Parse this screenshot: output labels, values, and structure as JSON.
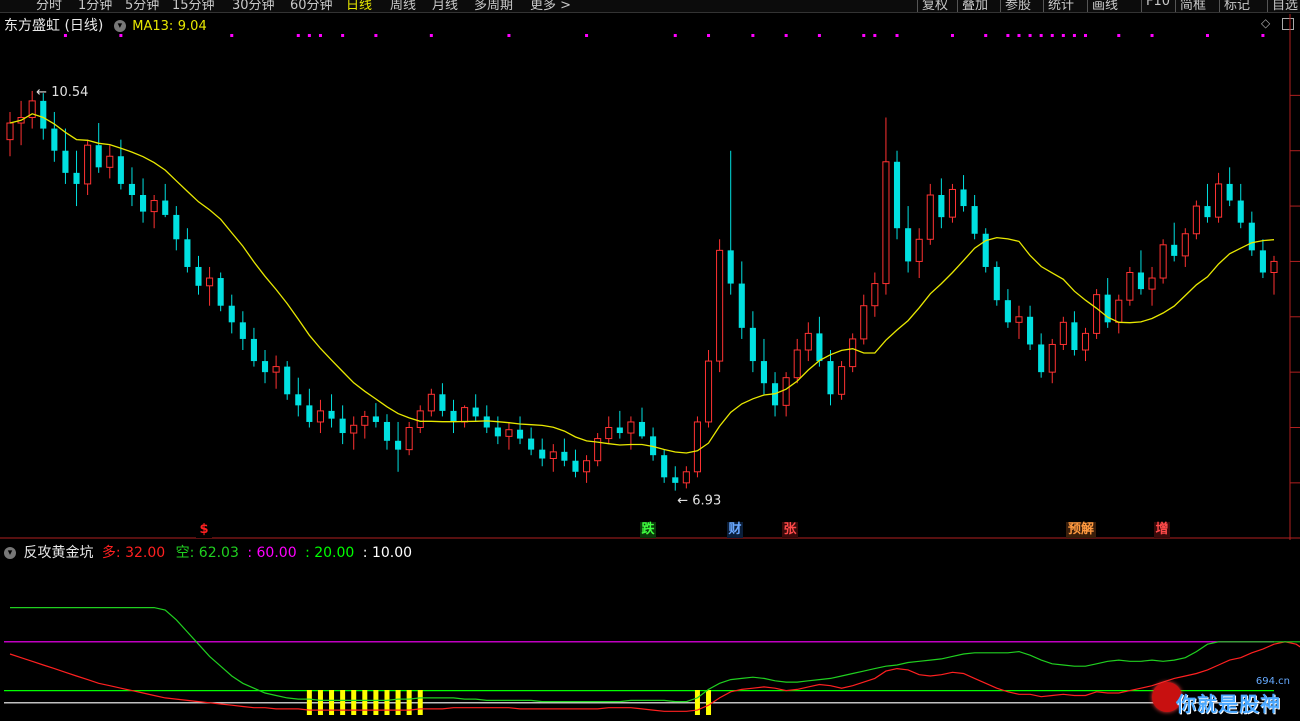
{
  "toolbar": {
    "left_items": [
      "分时",
      "1分钟",
      "5分钟",
      "15分钟",
      "30分钟",
      "60分钟",
      "日线",
      "周线",
      "月线",
      "多周期",
      "更多 >"
    ],
    "active_left": "日线",
    "right_items": [
      "复权",
      "叠加",
      "参股",
      "统计",
      "画线",
      "F10",
      "简框",
      "标记",
      "自选"
    ]
  },
  "main": {
    "title": "东方盛虹 (日线)",
    "ma_label": "MA13:",
    "ma_value": "9.04",
    "high_label": "10.54",
    "low_label": "6.93",
    "events": [
      {
        "text": "$",
        "color": "#ff2020",
        "bg": "#000000"
      },
      {
        "text": "跌",
        "color": "#40ff40",
        "bg": "#0a3a0a"
      },
      {
        "text": "财",
        "color": "#6aa8ff",
        "bg": "#0a1e3a"
      },
      {
        "text": "张",
        "color": "#ff4a4a",
        "bg": "#3a0a0a"
      },
      {
        "text": "预解",
        "color": "#ff9a40",
        "bg": "#3a1e0a"
      },
      {
        "text": "增",
        "color": "#ff4a4a",
        "bg": "#3a0a0a"
      }
    ]
  },
  "indicator": {
    "name": "反攻黄金坑",
    "long_label": "多:",
    "long_value": "32.00",
    "short_label": "空:",
    "short_value": "62.03",
    "sep": ":",
    "level_high": "60.00",
    "level_mid": "20.00",
    "level_low": "10.00"
  },
  "watermark": {
    "text": "你就是股神",
    "site": "694.cn"
  },
  "colors": {
    "up_candle": "#ff3232",
    "down_candle": "#00e0e0",
    "ma_line": "#e8e800",
    "long_line": "#ff2020",
    "short_line": "#20d020",
    "level_high_line": "#ff00ff",
    "level_mid_line": "#00ff00",
    "level_low_line": "#ffffff",
    "golden_pit_bar": "#ffff00",
    "marker_dot": "#ff00ff"
  },
  "chart_data": [
    {
      "type": "candlestick",
      "title": "东方盛虹 (日线)",
      "ylim": [
        6.8,
        11.0
      ],
      "y_gridlines": [
        10.5,
        10.0,
        9.5,
        9.0,
        8.5,
        8.0,
        7.5,
        7.0
      ],
      "ma13_last": 9.04,
      "period_high": 10.54,
      "period_low": 6.93,
      "ohlc": [
        [
          10.1,
          10.35,
          9.95,
          10.25
        ],
        [
          10.25,
          10.45,
          10.05,
          10.3
        ],
        [
          10.3,
          10.54,
          10.2,
          10.45
        ],
        [
          10.45,
          10.52,
          10.1,
          10.2
        ],
        [
          10.2,
          10.35,
          9.9,
          10.0
        ],
        [
          10.0,
          10.2,
          9.7,
          9.8
        ],
        [
          9.8,
          10.0,
          9.5,
          9.7
        ],
        [
          9.7,
          10.1,
          9.6,
          10.05
        ],
        [
          10.05,
          10.25,
          9.8,
          9.85
        ],
        [
          9.85,
          10.05,
          9.75,
          9.95
        ],
        [
          9.95,
          10.1,
          9.65,
          9.7
        ],
        [
          9.7,
          9.85,
          9.5,
          9.6
        ],
        [
          9.6,
          9.75,
          9.35,
          9.45
        ],
        [
          9.45,
          9.6,
          9.3,
          9.55
        ],
        [
          9.55,
          9.7,
          9.4,
          9.42
        ],
        [
          9.42,
          9.5,
          9.1,
          9.2
        ],
        [
          9.2,
          9.3,
          8.9,
          8.95
        ],
        [
          8.95,
          9.05,
          8.7,
          8.78
        ],
        [
          8.78,
          8.95,
          8.6,
          8.85
        ],
        [
          8.85,
          8.9,
          8.55,
          8.6
        ],
        [
          8.6,
          8.7,
          8.35,
          8.45
        ],
        [
          8.45,
          8.55,
          8.2,
          8.3
        ],
        [
          8.3,
          8.4,
          8.05,
          8.1
        ],
        [
          8.1,
          8.2,
          7.9,
          8.0
        ],
        [
          8.0,
          8.15,
          7.85,
          8.05
        ],
        [
          8.05,
          8.1,
          7.75,
          7.8
        ],
        [
          7.8,
          7.95,
          7.6,
          7.7
        ],
        [
          7.7,
          7.85,
          7.5,
          7.55
        ],
        [
          7.55,
          7.75,
          7.45,
          7.65
        ],
        [
          7.65,
          7.8,
          7.5,
          7.58
        ],
        [
          7.58,
          7.7,
          7.35,
          7.45
        ],
        [
          7.45,
          7.6,
          7.3,
          7.52
        ],
        [
          7.52,
          7.65,
          7.4,
          7.6
        ],
        [
          7.6,
          7.72,
          7.5,
          7.55
        ],
        [
          7.55,
          7.62,
          7.3,
          7.38
        ],
        [
          7.38,
          7.55,
          7.1,
          7.3
        ],
        [
          7.3,
          7.55,
          7.25,
          7.5
        ],
        [
          7.5,
          7.7,
          7.45,
          7.65
        ],
        [
          7.65,
          7.85,
          7.6,
          7.8
        ],
        [
          7.8,
          7.9,
          7.6,
          7.65
        ],
        [
          7.65,
          7.75,
          7.45,
          7.55
        ],
        [
          7.55,
          7.7,
          7.5,
          7.68
        ],
        [
          7.68,
          7.8,
          7.55,
          7.6
        ],
        [
          7.6,
          7.7,
          7.45,
          7.5
        ],
        [
          7.5,
          7.6,
          7.35,
          7.42
        ],
        [
          7.42,
          7.55,
          7.3,
          7.48
        ],
        [
          7.48,
          7.6,
          7.35,
          7.4
        ],
        [
          7.4,
          7.5,
          7.25,
          7.3
        ],
        [
          7.3,
          7.4,
          7.15,
          7.22
        ],
        [
          7.22,
          7.35,
          7.1,
          7.28
        ],
        [
          7.28,
          7.4,
          7.15,
          7.2
        ],
        [
          7.2,
          7.3,
          7.05,
          7.1
        ],
        [
          7.1,
          7.25,
          7.0,
          7.2
        ],
        [
          7.2,
          7.45,
          7.15,
          7.4
        ],
        [
          7.4,
          7.6,
          7.35,
          7.5
        ],
        [
          7.5,
          7.65,
          7.4,
          7.45
        ],
        [
          7.45,
          7.6,
          7.3,
          7.55
        ],
        [
          7.55,
          7.68,
          7.4,
          7.42
        ],
        [
          7.42,
          7.5,
          7.2,
          7.25
        ],
        [
          7.25,
          7.3,
          7.0,
          7.05
        ],
        [
          7.05,
          7.15,
          6.93,
          7.0
        ],
        [
          7.0,
          7.15,
          6.95,
          7.1
        ],
        [
          7.1,
          7.6,
          7.05,
          7.55
        ],
        [
          7.55,
          8.2,
          7.5,
          8.1
        ],
        [
          8.1,
          9.2,
          8.0,
          9.1
        ],
        [
          9.1,
          10.0,
          8.7,
          8.8
        ],
        [
          8.8,
          9.0,
          8.3,
          8.4
        ],
        [
          8.4,
          8.55,
          8.0,
          8.1
        ],
        [
          8.1,
          8.3,
          7.8,
          7.9
        ],
        [
          7.9,
          8.0,
          7.6,
          7.7
        ],
        [
          7.7,
          8.0,
          7.6,
          7.95
        ],
        [
          7.95,
          8.3,
          7.9,
          8.2
        ],
        [
          8.2,
          8.45,
          8.1,
          8.35
        ],
        [
          8.35,
          8.5,
          8.05,
          8.1
        ],
        [
          8.1,
          8.2,
          7.7,
          7.8
        ],
        [
          7.8,
          8.1,
          7.75,
          8.05
        ],
        [
          8.05,
          8.35,
          8.0,
          8.3
        ],
        [
          8.3,
          8.7,
          8.25,
          8.6
        ],
        [
          8.6,
          8.9,
          8.5,
          8.8
        ],
        [
          8.8,
          10.3,
          8.7,
          9.9
        ],
        [
          9.9,
          10.0,
          9.2,
          9.3
        ],
        [
          9.3,
          9.5,
          8.9,
          9.0
        ],
        [
          9.0,
          9.3,
          8.85,
          9.2
        ],
        [
          9.2,
          9.7,
          9.15,
          9.6
        ],
        [
          9.6,
          9.75,
          9.3,
          9.4
        ],
        [
          9.4,
          9.7,
          9.35,
          9.65
        ],
        [
          9.65,
          9.78,
          9.45,
          9.5
        ],
        [
          9.5,
          9.6,
          9.2,
          9.25
        ],
        [
          9.25,
          9.3,
          8.9,
          8.95
        ],
        [
          8.95,
          9.0,
          8.6,
          8.65
        ],
        [
          8.65,
          8.75,
          8.4,
          8.45
        ],
        [
          8.45,
          8.6,
          8.3,
          8.5
        ],
        [
          8.5,
          8.6,
          8.2,
          8.25
        ],
        [
          8.25,
          8.35,
          7.95,
          8.0
        ],
        [
          8.0,
          8.3,
          7.9,
          8.25
        ],
        [
          8.25,
          8.5,
          8.2,
          8.45
        ],
        [
          8.45,
          8.55,
          8.15,
          8.2
        ],
        [
          8.2,
          8.4,
          8.1,
          8.35
        ],
        [
          8.35,
          8.75,
          8.3,
          8.7
        ],
        [
          8.7,
          8.85,
          8.4,
          8.45
        ],
        [
          8.45,
          8.7,
          8.35,
          8.65
        ],
        [
          8.65,
          8.95,
          8.6,
          8.9
        ],
        [
          8.9,
          9.1,
          8.7,
          8.75
        ],
        [
          8.75,
          8.95,
          8.6,
          8.85
        ],
        [
          8.85,
          9.2,
          8.8,
          9.15
        ],
        [
          9.15,
          9.35,
          9.0,
          9.05
        ],
        [
          9.05,
          9.3,
          8.95,
          9.25
        ],
        [
          9.25,
          9.55,
          9.2,
          9.5
        ],
        [
          9.5,
          9.7,
          9.35,
          9.4
        ],
        [
          9.4,
          9.8,
          9.35,
          9.7
        ],
        [
          9.7,
          9.85,
          9.5,
          9.55
        ],
        [
          9.55,
          9.7,
          9.3,
          9.35
        ],
        [
          9.35,
          9.45,
          9.05,
          9.1
        ],
        [
          9.1,
          9.2,
          8.85,
          8.9
        ],
        [
          8.9,
          9.05,
          8.7,
          9.0
        ]
      ]
    },
    {
      "type": "line",
      "title": "反攻黄金坑",
      "ylim": [
        0,
        100
      ],
      "levels": [
        60,
        20,
        10
      ],
      "series": [
        {
          "name": "多",
          "last": 32.0,
          "values": [
            50,
            47,
            44,
            41,
            38,
            35,
            32,
            29,
            26,
            24,
            22,
            20,
            18,
            16,
            14,
            13,
            12,
            11,
            10,
            9,
            8,
            7,
            6,
            6,
            5,
            5,
            5,
            4,
            4,
            4,
            4,
            4,
            4,
            4,
            4,
            4,
            4,
            5,
            5,
            5,
            6,
            6,
            6,
            6,
            6,
            6,
            5,
            5,
            5,
            5,
            5,
            5,
            5,
            5,
            6,
            6,
            6,
            5,
            4,
            3,
            3,
            3,
            4,
            8,
            14,
            19,
            21,
            22,
            23,
            22,
            20,
            21,
            23,
            25,
            24,
            22,
            24,
            27,
            30,
            36,
            38,
            37,
            33,
            32,
            33,
            35,
            34,
            30,
            26,
            22,
            19,
            17,
            17,
            15,
            16,
            17,
            16,
            16,
            19,
            18,
            18,
            20,
            22,
            24,
            27,
            30,
            32,
            34,
            37,
            41,
            45,
            47,
            51,
            54,
            58,
            60,
            58,
            52,
            45,
            38,
            33,
            32
          ]
        },
        {
          "name": "空",
          "last": 62.03,
          "values": [
            88,
            88,
            88,
            88,
            88,
            88,
            88,
            88,
            88,
            88,
            88,
            88,
            88,
            88,
            86,
            78,
            68,
            58,
            48,
            40,
            32,
            26,
            22,
            18,
            16,
            14,
            13,
            13,
            12,
            12,
            12,
            12,
            12,
            12,
            12,
            13,
            13,
            14,
            14,
            14,
            14,
            13,
            13,
            12,
            12,
            12,
            12,
            12,
            11,
            11,
            11,
            11,
            11,
            11,
            11,
            11,
            12,
            12,
            12,
            12,
            11,
            11,
            14,
            21,
            26,
            29,
            30,
            31,
            30,
            28,
            27,
            27,
            28,
            29,
            30,
            32,
            34,
            36,
            38,
            40,
            41,
            43,
            44,
            45,
            46,
            48,
            50,
            51,
            51,
            51,
            51,
            52,
            49,
            45,
            42,
            41,
            40,
            40,
            42,
            44,
            45,
            44,
            44,
            45,
            44,
            45,
            47,
            52,
            58,
            60,
            60,
            60,
            60,
            60,
            60,
            60,
            60,
            60,
            61,
            62,
            62,
            62.03
          ]
        }
      ],
      "golden_pit_bars": [
        [
          27,
          37
        ],
        [
          62,
          63
        ]
      ]
    }
  ]
}
